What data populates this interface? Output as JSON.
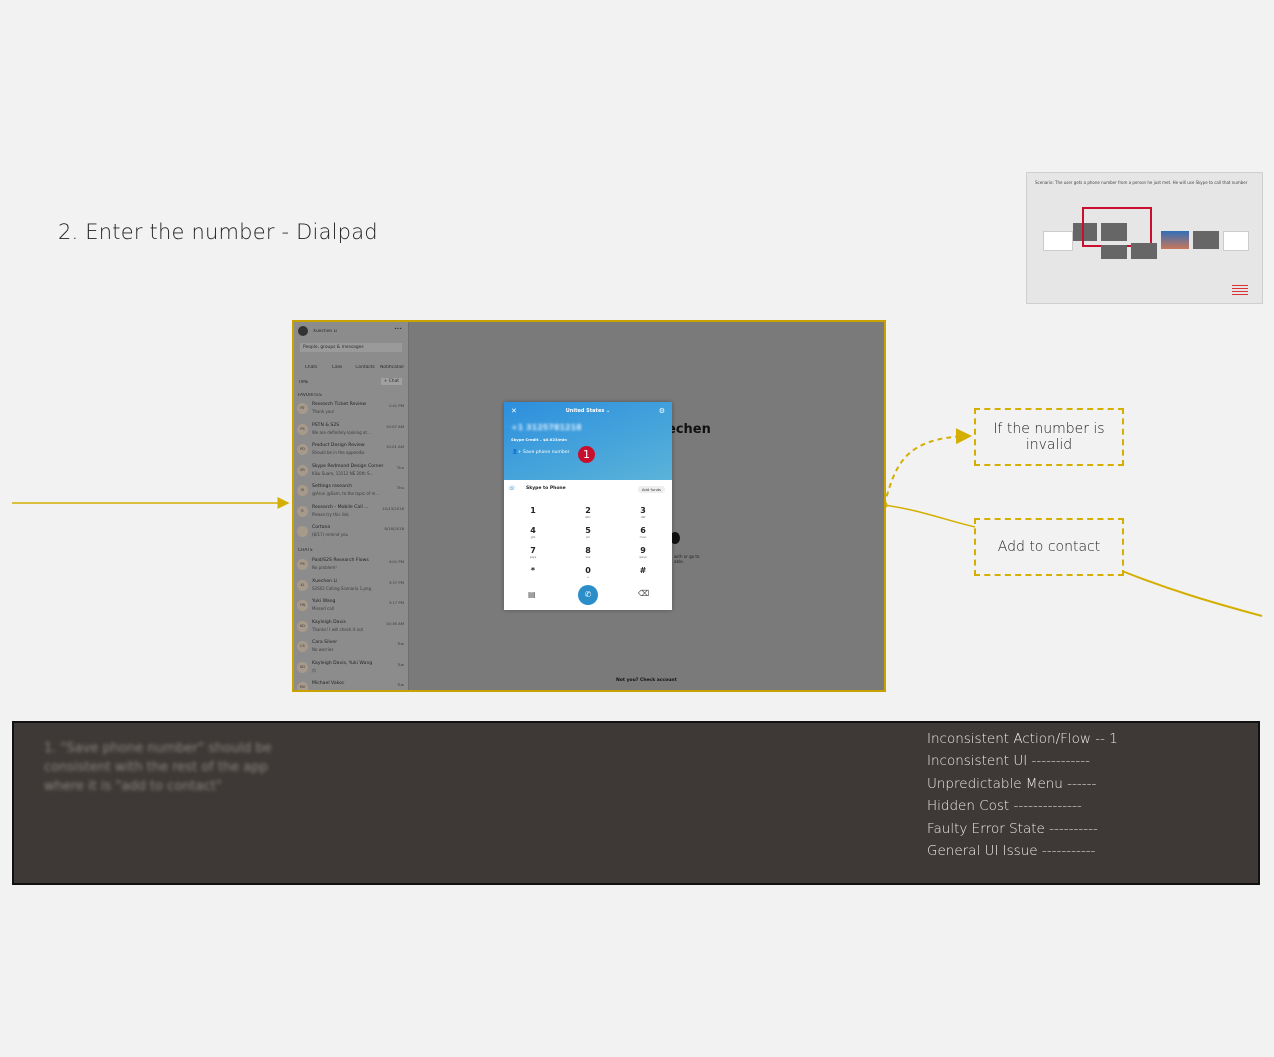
{
  "page_title": "2. Enter the number - Dialpad",
  "thumbnail": {
    "caption": "Scenario: The user gets a phone number from a person he just met. He will use Skype to call that number"
  },
  "screenshot": {
    "sidebar": {
      "user": "Xuechen Li",
      "search_placeholder": "People, groups & messages",
      "nav": [
        "Chats",
        "Calls",
        "Contacts",
        "Notifications"
      ],
      "section_time": "TIME",
      "new_chat": "+ Chat",
      "section_favorites": "FAVORITES",
      "section_chats": "CHATS",
      "favorites": [
        {
          "initials": "RT",
          "name": "Research Ticket Review",
          "sub": "Thank you!",
          "time": "1:41 PM"
        },
        {
          "initials": "PS",
          "name": "PSTN & S2S",
          "sub": "We are definitely looking at...",
          "time": "10:07 AM"
        },
        {
          "initials": "PD",
          "name": "Product Design Review",
          "sub": "Should be in the appendix",
          "time": "10:01 AM"
        },
        {
          "initials": "SR",
          "name": "Skype Redmond Design Corner",
          "sub": "Kiku Suam, 13112 NE 20th S...",
          "time": "Thu"
        },
        {
          "initials": "SI",
          "name": "Settings research",
          "sub": "@Arun @Sam, to the topic of m...",
          "time": "Thu"
        },
        {
          "initials": "R",
          "name": "Research - Mobile Call ...",
          "sub": "Please try this link",
          "time": "10/13/2018"
        },
        {
          "initials": "",
          "name": "Cortana",
          "sub": "(8/17) remind you",
          "time": "8/18/2018"
        }
      ],
      "chats": [
        {
          "initials": "PS",
          "name": "Paid/S2S Research Flows",
          "sub": "No problem!",
          "time": "4:01 PM"
        },
        {
          "initials": "XL",
          "name": "Xuechen Li",
          "sub": "S2S03 Calling Scenario 1.png",
          "time": "3:37 PM"
        },
        {
          "initials": "YW",
          "name": "Yuki Wang",
          "sub": "Missed call",
          "time": "3:17 PM"
        },
        {
          "initials": "KD",
          "name": "Kayleigh Davis",
          "sub": "Thanks! I will check it out",
          "time": "10:36 AM"
        },
        {
          "initials": "CS",
          "name": "Cara Silver",
          "sub": "No worries",
          "time": "Tue"
        },
        {
          "initials": "KD",
          "name": "Kayleigh Davis, Yuki Wang",
          "sub": "😊",
          "time": "Tue"
        },
        {
          "initials": "MV",
          "name": "Michael Vakoc",
          "sub": "",
          "time": "Tue"
        }
      ]
    },
    "background_name_fragment": "echen",
    "background_note": "with or go to able.",
    "footer": "Not you? Check account",
    "dialpad": {
      "country": "United States ⌄",
      "number": "+1 3125781218",
      "credit": "Skype Credit – $0.023/min",
      "save_label": "Save phone number",
      "badge": "1",
      "skype_to_phone": "Skype to Phone",
      "add_funds": "Add funds",
      "keys": [
        {
          "d": "1",
          "l": ""
        },
        {
          "d": "2",
          "l": "abc"
        },
        {
          "d": "3",
          "l": "def"
        },
        {
          "d": "4",
          "l": "ghi"
        },
        {
          "d": "5",
          "l": "jkl"
        },
        {
          "d": "6",
          "l": "mno"
        },
        {
          "d": "7",
          "l": "pqrs"
        },
        {
          "d": "8",
          "l": "tuv"
        },
        {
          "d": "9",
          "l": "wxyz"
        },
        {
          "d": "*",
          "l": ""
        },
        {
          "d": "0",
          "l": "+"
        },
        {
          "d": "#",
          "l": ""
        }
      ]
    }
  },
  "annotations": {
    "invalid": "If the number is invalid",
    "add_contact": "Add to contact"
  },
  "issues_panel": {
    "note": "1.  \"Save phone number\" should be consistent with the rest of the app where it is \"add to contact\"",
    "categories": [
      "Inconsistent Action/Flow -- 1",
      "Inconsistent UI ------------",
      "Unpredictable Menu ------",
      "Hidden Cost --------------",
      "Faulty Error State ----------",
      "General UI Issue -----------"
    ]
  },
  "colors": {
    "accent_yellow": "#d4af00",
    "badge_red": "#c8102e",
    "panel_bg": "#3e3936"
  }
}
